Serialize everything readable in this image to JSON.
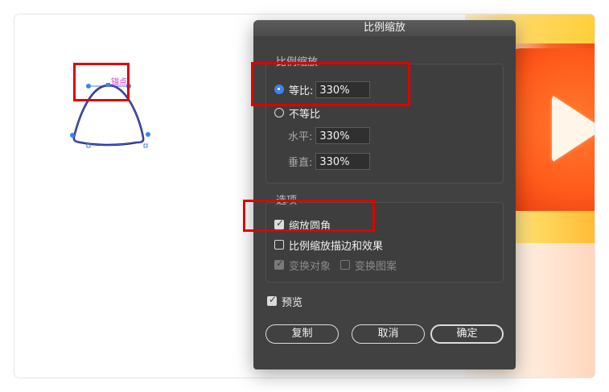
{
  "dialog": {
    "title": "比例缩放",
    "scale_group": {
      "legend": "比例缩放",
      "uniform": {
        "label": "等比:",
        "value": "330%",
        "selected": true
      },
      "non_uniform": {
        "label": "不等比",
        "selected": false
      },
      "horizontal": {
        "label": "水平:",
        "value": "330%"
      },
      "vertical": {
        "label": "垂直:",
        "value": "330%"
      }
    },
    "options_group": {
      "legend": "选项",
      "scale_corners": {
        "label": "缩放圆角",
        "checked": true
      },
      "scale_strokes_effects": {
        "label": "比例缩放描边和效果",
        "checked": false
      },
      "transform_objects": {
        "label": "变换对象",
        "checked": true,
        "disabled": true
      },
      "transform_patterns": {
        "label": "变换图案",
        "checked": false,
        "disabled": true
      }
    },
    "preview": {
      "label": "预览",
      "checked": true
    },
    "buttons": {
      "copy": "复制",
      "cancel": "取消",
      "ok": "确定"
    }
  },
  "canvas": {
    "anchor_label": "锚点"
  },
  "colors": {
    "dialog_bg": "#414141",
    "accent_blue": "#3b82f6",
    "highlight_red": "#e00000",
    "shape_stroke": "#1f1a5a",
    "anchor_label": "#d83bd8"
  }
}
